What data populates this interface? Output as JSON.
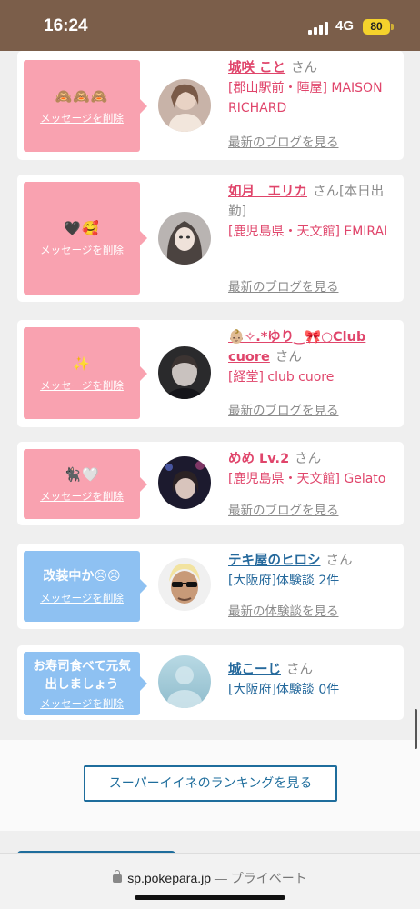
{
  "status": {
    "time": "16:24",
    "network": "4G",
    "battery": "80"
  },
  "cards": [
    {
      "message": "🙈🙈🙈",
      "delete_label": "メッセージを削除",
      "name": "城咲 こと",
      "san": "さん",
      "shop": "[郡山駅前・陣屋] MAISON RICHARD",
      "blog": "最新のブログを見る",
      "avatar": "avatar-photo"
    },
    {
      "message": "🖤🥰",
      "delete_label": "メッセージを削除",
      "name": "如月　エリカ",
      "san": "さん[本日出勤]",
      "shop": "[鹿児島県・天文館] EMIRAI",
      "blog": "最新のブログを見る",
      "avatar": "avatar-photo"
    },
    {
      "message": "✨",
      "delete_label": "メッセージを削除",
      "name": "👶🏼✧.*ゆり‿🎀○Club cuore",
      "san": "さん",
      "shop": "[経堂] club cuore",
      "blog": "最新のブログを見る",
      "avatar": "avatar-photo"
    },
    {
      "message": "🐈‍⬛🤍",
      "delete_label": "メッセージを削除",
      "name": "めめ Lv.2",
      "san": "さん",
      "shop": "[鹿児島県・天文館] Gelato",
      "blog": "最新のブログを見る",
      "avatar": "avatar-photo"
    },
    {
      "message": "改装中か😣😣",
      "delete_label": "メッセージを削除",
      "name": "テキ屋のヒロシ",
      "san": "さん",
      "shop": "[大阪府]体験談 2件",
      "blog": "最新の体験談を見る",
      "avatar": "avatar-photo"
    },
    {
      "message": "お寿司食べて元気出しましょう",
      "delete_label": "メッセージを削除",
      "name": "城こーじ",
      "san": "さん",
      "shop": "[大阪府]体験談 0件",
      "blog": "",
      "avatar": "no-photo-placeholder",
      "avatar_text": "no photo"
    }
  ],
  "ranking_button": "スーパーイイネのランキングを見る",
  "browser": {
    "url": "sp.pokepara.jp",
    "privacy": "— プライベート"
  },
  "colors": {
    "pink": "#f9a2b0",
    "blue": "#8ec1f2",
    "name_pink": "#e0456b",
    "name_blue": "#25699c"
  }
}
